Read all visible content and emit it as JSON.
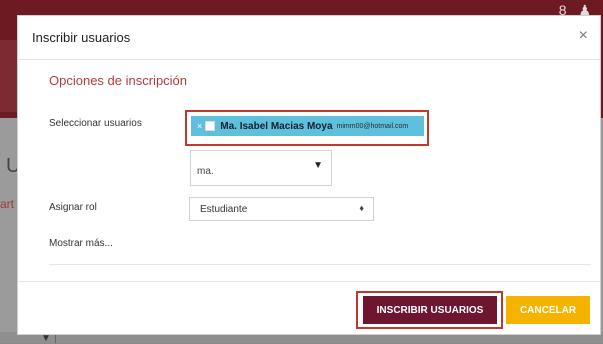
{
  "modal": {
    "title": "Inscribir usuarios",
    "close_icon": "×",
    "section_title": "Opciones de inscripción",
    "select_users_label": "Seleccionar usuarios",
    "selected_user": {
      "remove_icon": "×",
      "name": "Ma. Isabel Macias Moya",
      "email": "mimm00@hotmail.com"
    },
    "search": {
      "value": "ma.",
      "caret": "▼"
    },
    "assign_role_label": "Asignar rol",
    "role": {
      "selected": "Estudiante",
      "caret": "♦"
    },
    "show_more": "Mostrar más...",
    "buttons": {
      "enrol": "INSCRIBIR USUARIOS",
      "cancel": "CANCELAR"
    }
  },
  "background": {
    "side_letter_1": "U",
    "side_letter_2": "art",
    "top_icons": "8 ♟",
    "bottom_arrow": "▼"
  },
  "colors": {
    "section_title": "#b33b3b",
    "chip": "#5fc0dd",
    "primary_button": "#6e1530",
    "cancel_button": "#f5b300",
    "highlight": "#c0392b"
  }
}
